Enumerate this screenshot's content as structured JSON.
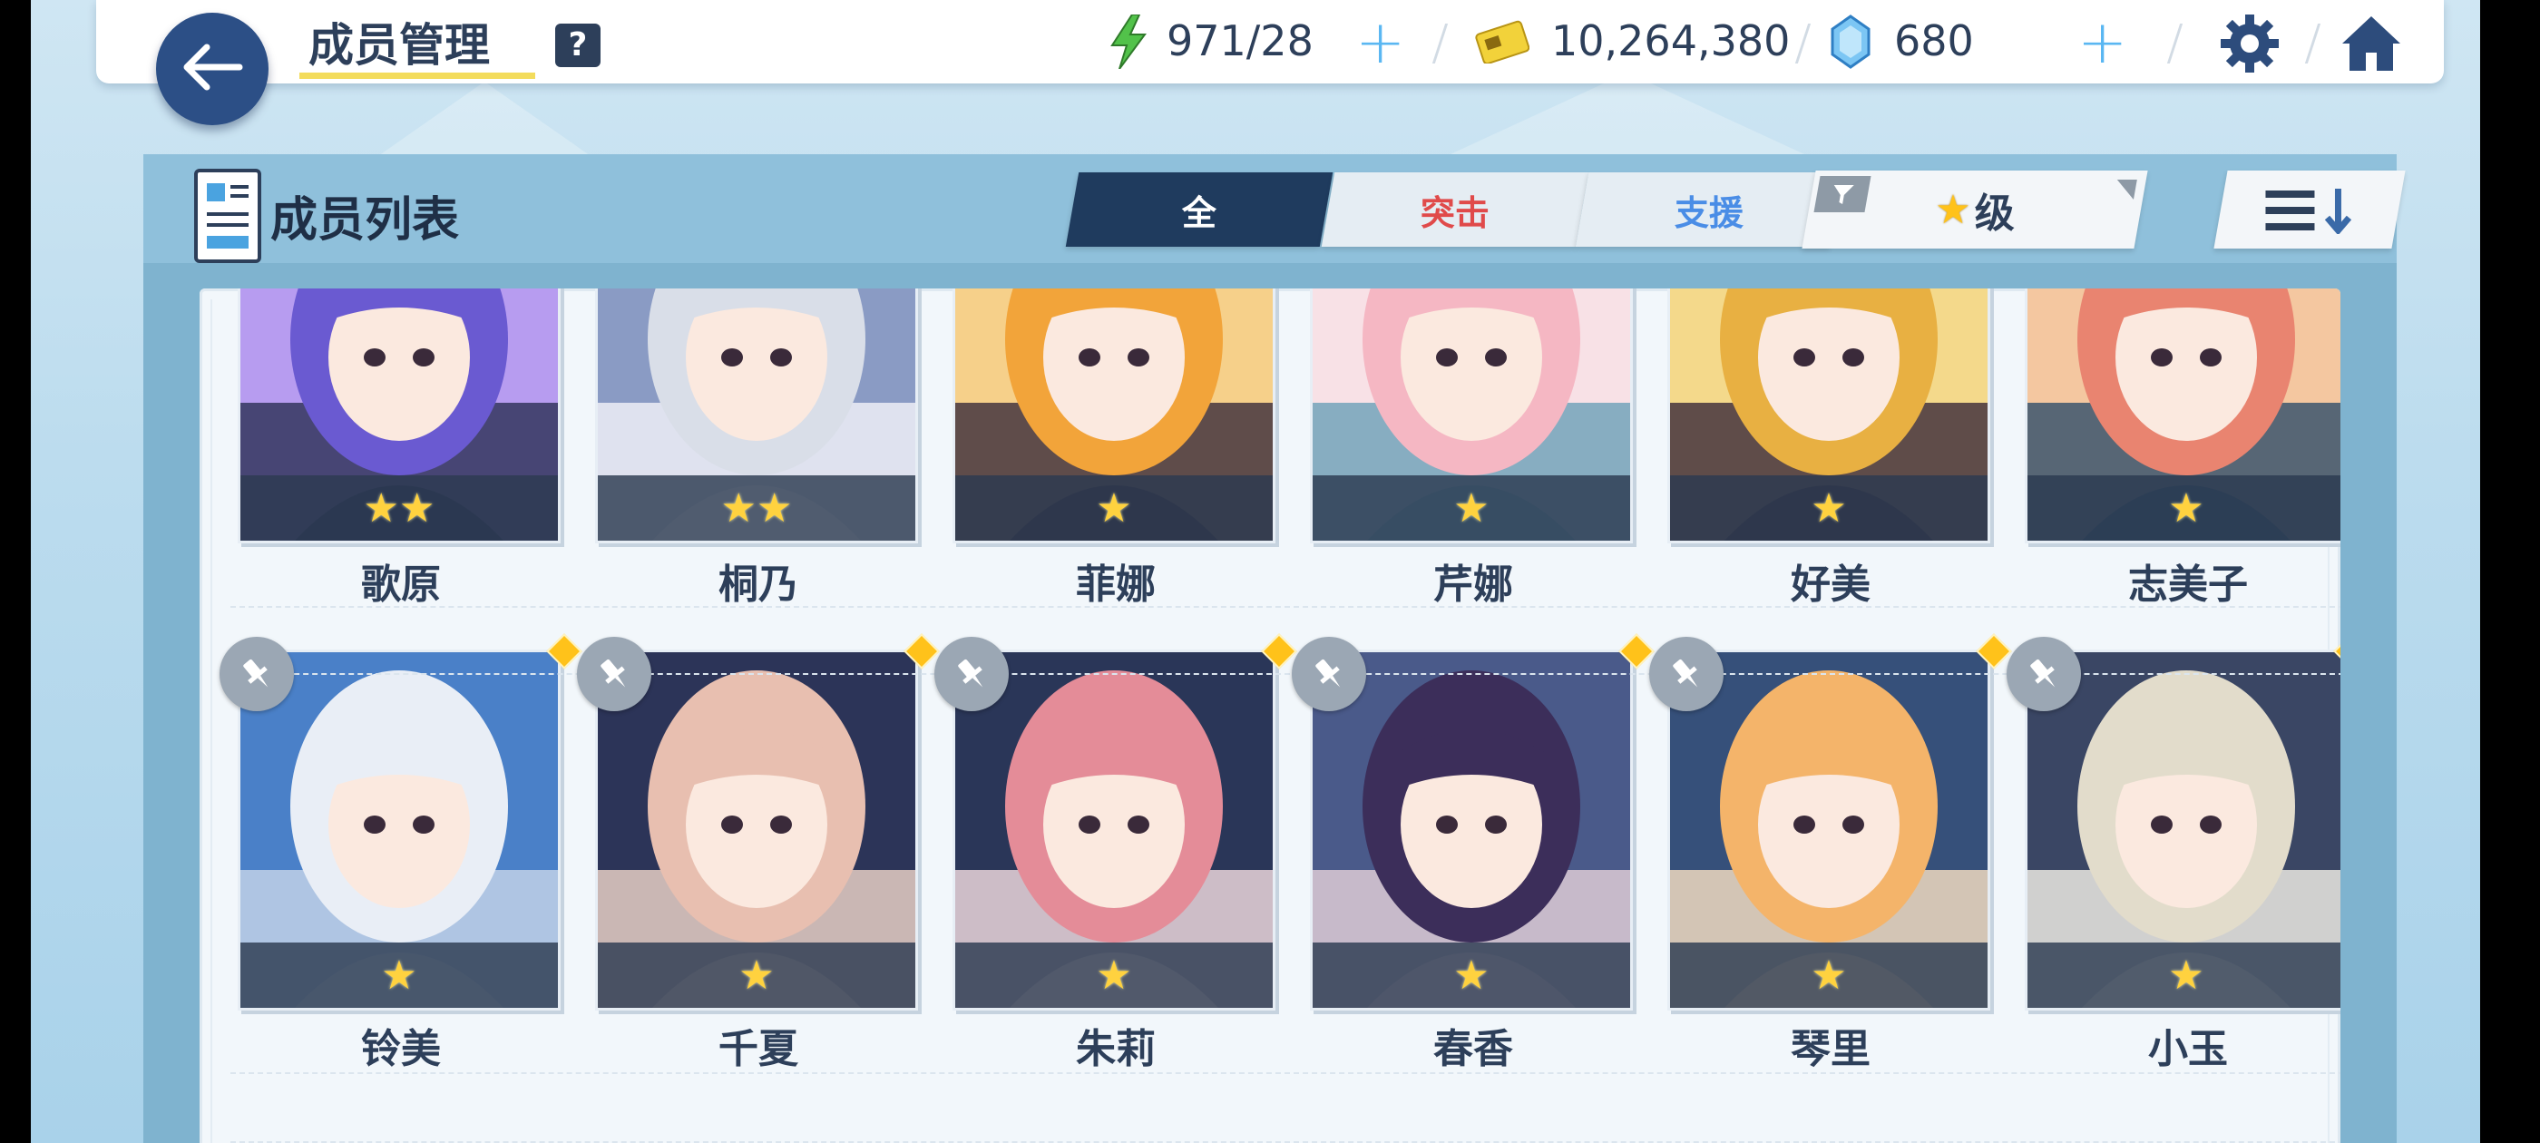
{
  "header": {
    "title": "成员管理",
    "help_label": "?",
    "stamina": "971/28",
    "credits": "10,264,380",
    "gems": "680",
    "accent": "#5ab7f2"
  },
  "panel": {
    "title": "成员列表",
    "tabs": [
      {
        "label": "全",
        "active": true,
        "color": "#ffffff"
      },
      {
        "label": "突击",
        "active": false,
        "color": "#e04a4a"
      },
      {
        "label": "支援",
        "active": false,
        "color": "#4a8de6"
      }
    ],
    "filter_label": "级",
    "sort_icon": "sort-descending-icon"
  },
  "members_row1": [
    {
      "name": "歌原",
      "stars": "★★",
      "palette": [
        "#6a5ad1",
        "#b79cf0",
        "#2a2f55"
      ]
    },
    {
      "name": "桐乃",
      "stars": "★★",
      "palette": [
        "#d9dee8",
        "#8a9bc4",
        "#f4f4fa"
      ]
    },
    {
      "name": "菲娜",
      "stars": "★",
      "palette": [
        "#f2a43a",
        "#f6d08a",
        "#3a2a3a"
      ]
    },
    {
      "name": "芹娜",
      "stars": "★",
      "palette": [
        "#f5b7c3",
        "#f8e1e6",
        "#6aa0b8"
      ]
    },
    {
      "name": "好美",
      "stars": "★",
      "palette": [
        "#e8b042",
        "#f4d98b",
        "#3a2838"
      ]
    },
    {
      "name": "志美子",
      "stars": "★",
      "palette": [
        "#e98470",
        "#f4c7a0",
        "#2f4e6a"
      ]
    }
  ],
  "members_row2": [
    {
      "name": "铃美",
      "stars": "★",
      "palette": [
        "#e9eef6",
        "#4a80c8",
        "#c8d6ea"
      ]
    },
    {
      "name": "千夏",
      "stars": "★",
      "palette": [
        "#e8bfb0",
        "#2c3458",
        "#f2d8cc"
      ]
    },
    {
      "name": "朱莉",
      "stars": "★",
      "palette": [
        "#e48c98",
        "#2a3658",
        "#f6e0e4"
      ]
    },
    {
      "name": "春香",
      "stars": "★",
      "palette": [
        "#3c2e5a",
        "#4a5a8a",
        "#e6d2da"
      ]
    },
    {
      "name": "琴里",
      "stars": "★",
      "palette": [
        "#f4b46a",
        "#36507a",
        "#fbe2c4"
      ]
    },
    {
      "name": "小玉",
      "stars": "★",
      "palette": [
        "#e2dccb",
        "#3a4664",
        "#f6f2ea"
      ]
    }
  ]
}
